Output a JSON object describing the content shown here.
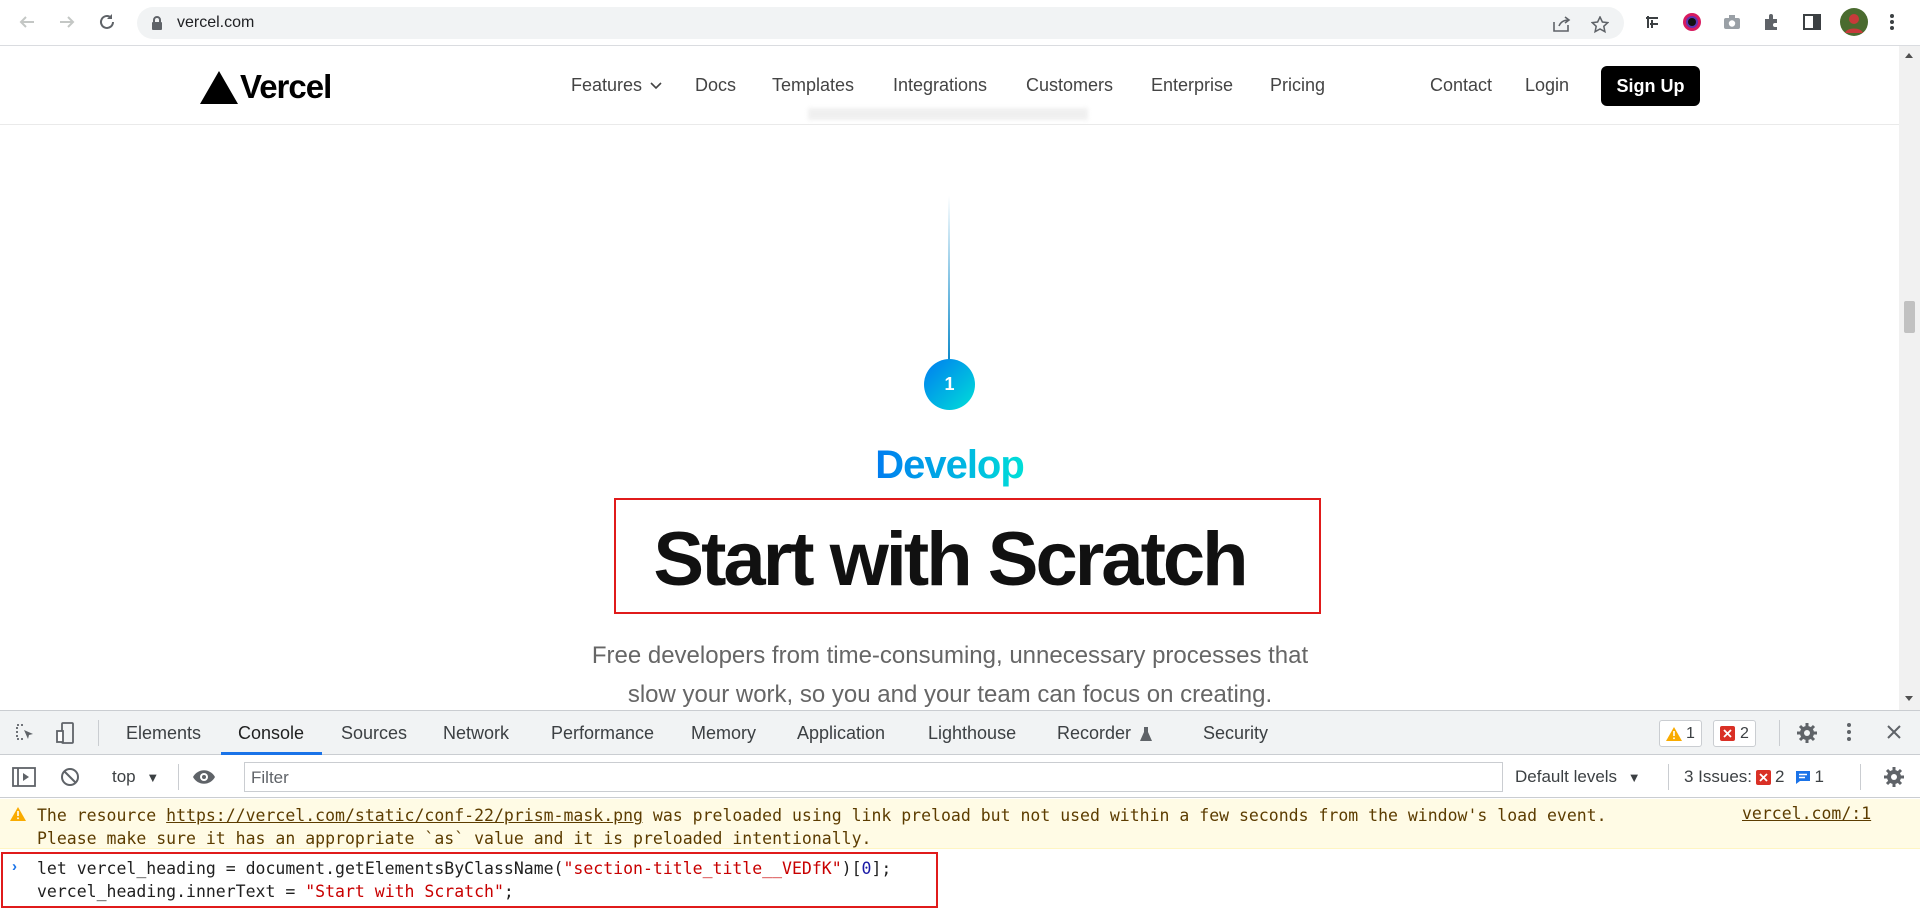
{
  "browser": {
    "url": "vercel.com"
  },
  "site": {
    "logo_text": "Vercel",
    "nav": [
      "Features",
      "Docs",
      "Templates",
      "Integrations",
      "Customers",
      "Enterprise",
      "Pricing"
    ],
    "contact": "Contact",
    "login": "Login",
    "signup": "Sign Up"
  },
  "section": {
    "step_number": "1",
    "kicker": "Develop",
    "headline": "Start with Scratch",
    "subtext_line1": "Free developers from time-consuming, unnecessary processes that",
    "subtext_line2": "slow your work, so you and your team can focus on creating."
  },
  "devtools": {
    "tabs": [
      "Elements",
      "Console",
      "Sources",
      "Network",
      "Performance",
      "Memory",
      "Application",
      "Lighthouse",
      "Recorder",
      "Security"
    ],
    "active_tab": "Console",
    "warning_count": "1",
    "error_count": "2",
    "context": "top",
    "filter_placeholder": "Filter",
    "levels": "Default levels",
    "issues_label": "3 Issues:",
    "issues_errors": "2",
    "issues_info": "1",
    "warning": {
      "prefix": "The resource ",
      "link": "https://vercel.com/static/conf-22/prism-mask.png",
      "suffix": " was preloaded using link preload but not used within a few seconds from the window's load event.",
      "line2": "Please make sure it has an appropriate `as` value and it is preloaded intentionally.",
      "source": "vercel.com/:1"
    },
    "command": {
      "l1_a": "let vercel_heading = document.getElementsByClassName(",
      "l1_str": "\"section-title_title__VEDfK\"",
      "l1_b": ")[",
      "l1_num": "0",
      "l1_c": "];",
      "l2_a": "vercel_heading.innerText = ",
      "l2_str": "\"Start with Scratch\"",
      "l2_b": ";"
    }
  }
}
